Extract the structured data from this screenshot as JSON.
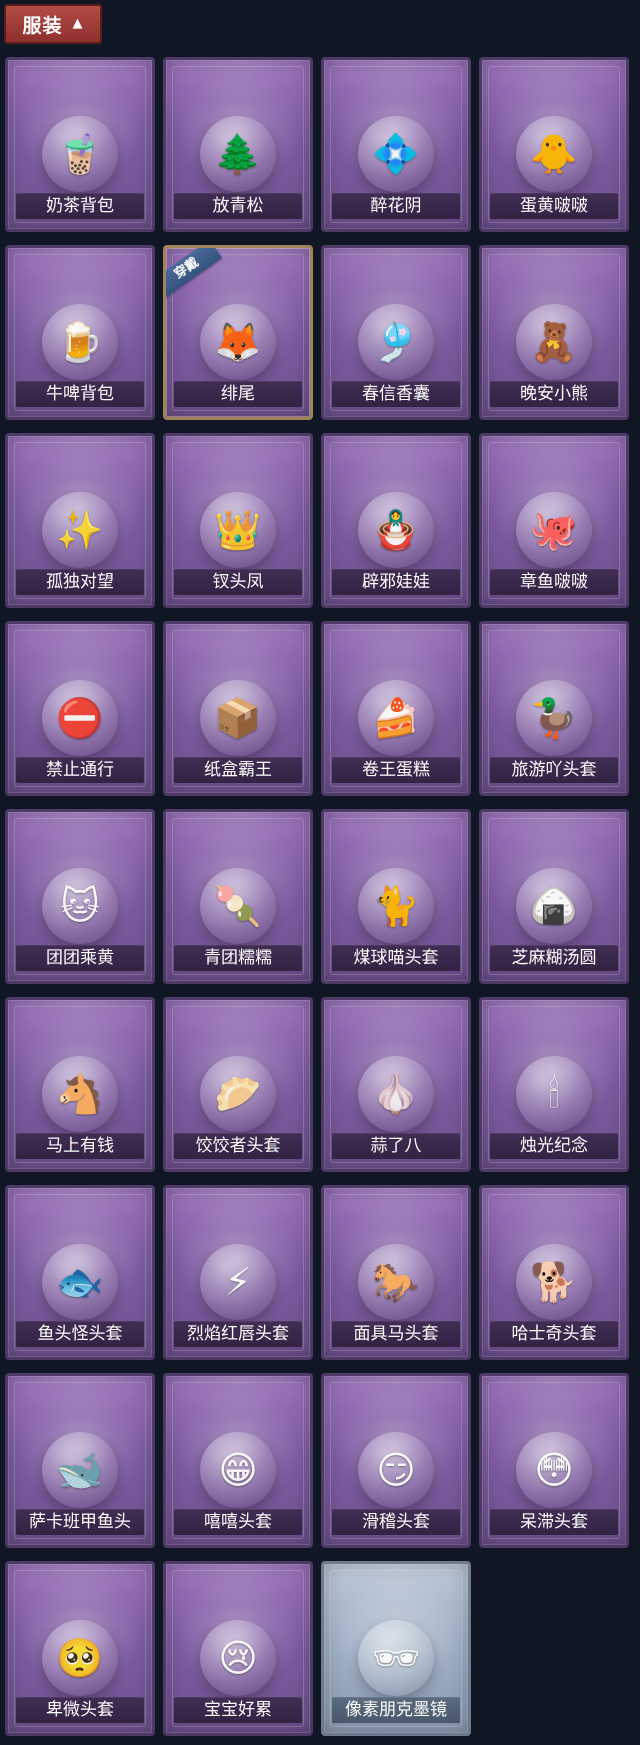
{
  "header": {
    "tab_label": "服装",
    "chevron": "▲"
  },
  "items": [
    {
      "name": "奶茶背包",
      "icon": "🧋"
    },
    {
      "name": "放青松",
      "icon": "🌲"
    },
    {
      "name": "醉花阴",
      "icon": "💠"
    },
    {
      "name": "蛋黄啵啵",
      "icon": "🐥"
    },
    {
      "name": "牛啤背包",
      "icon": "🍺"
    },
    {
      "name": "绯尾",
      "icon": "🦊",
      "badge": "穿戴",
      "special": true
    },
    {
      "name": "春信香囊",
      "icon": "🎐"
    },
    {
      "name": "晚安小熊",
      "icon": "🧸"
    },
    {
      "name": "孤独对望",
      "icon": "✨"
    },
    {
      "name": "钗头凤",
      "icon": "👑"
    },
    {
      "name": "辟邪娃娃",
      "icon": "🪆"
    },
    {
      "name": "章鱼啵啵",
      "icon": "🐙"
    },
    {
      "name": "禁止通行",
      "icon": "⛔"
    },
    {
      "name": "纸盒霸王",
      "icon": "📦"
    },
    {
      "name": "卷王蛋糕",
      "icon": "🍰"
    },
    {
      "name": "旅游吖头套",
      "icon": "🦆"
    },
    {
      "name": "团团乘黄",
      "icon": "🐱"
    },
    {
      "name": "青团糯糯",
      "icon": "🍡"
    },
    {
      "name": "煤球喵头套",
      "icon": "🐈"
    },
    {
      "name": "芝麻糊汤圆",
      "icon": "🍙"
    },
    {
      "name": "马上有钱",
      "icon": "🐴"
    },
    {
      "name": "饺饺者头套",
      "icon": "🥟"
    },
    {
      "name": "蒜了八",
      "icon": "🧄"
    },
    {
      "name": "烛光纪念",
      "icon": "🕯"
    },
    {
      "name": "鱼头怪头套",
      "icon": "🐟"
    },
    {
      "name": "烈焰红唇头套",
      "icon": "⚡"
    },
    {
      "name": "面具马头套",
      "icon": "🐎"
    },
    {
      "name": "哈士奇头套",
      "icon": "🐕"
    },
    {
      "name": "萨卡班甲鱼头",
      "icon": "🐋"
    },
    {
      "name": "嘻嘻头套",
      "icon": "😁"
    },
    {
      "name": "滑稽头套",
      "icon": "😏"
    },
    {
      "name": "呆滞头套",
      "icon": "😳"
    },
    {
      "name": "卑微头套",
      "icon": "🥺"
    },
    {
      "name": "宝宝好累",
      "icon": "😢"
    },
    {
      "name": "像素朋克墨镜",
      "icon": "🕶",
      "grey": true
    }
  ]
}
